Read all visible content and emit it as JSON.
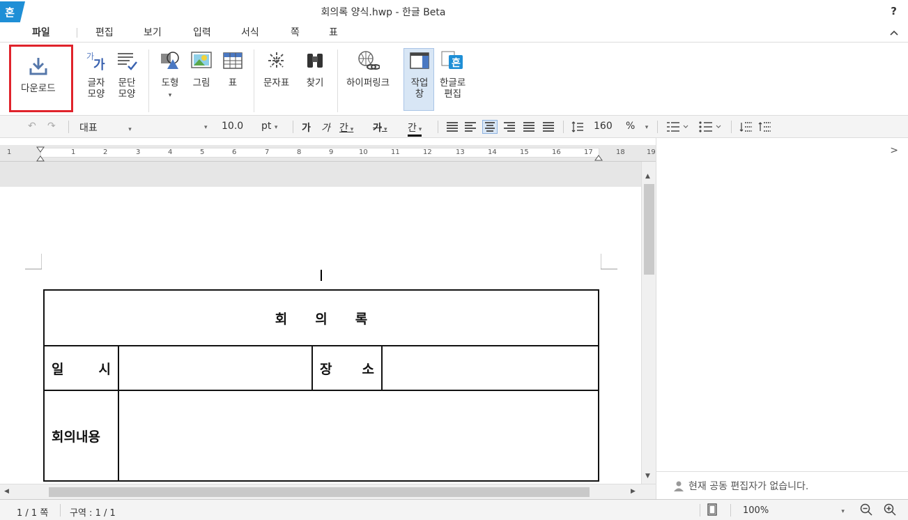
{
  "window": {
    "title": "회의록 양식.hwp - 한글 Beta",
    "logo": "혼",
    "help": "?"
  },
  "menu": {
    "tabs": [
      "파일",
      "편집",
      "보기",
      "입력",
      "서식",
      "쪽",
      "표"
    ],
    "collapse": "^"
  },
  "ribbon": {
    "download": "다운로드",
    "char_shape_1": "글자",
    "char_shape_2": "모양",
    "para_shape_1": "문단",
    "para_shape_2": "모양",
    "shape": "도형",
    "picture": "그림",
    "table": "표",
    "char_map": "문자표",
    "find": "찾기",
    "hyperlink": "하이퍼링크",
    "task_pane_1": "작업",
    "task_pane_2": "창",
    "hangul_edit_1": "한글로",
    "hangul_edit_2": "편집"
  },
  "format": {
    "style": "대표",
    "font_size": "10.0",
    "unit": "pt",
    "line_spacing": "160",
    "percent": "%",
    "bold_glyph": "가",
    "italic_glyph": "가",
    "underline_glyph": "간",
    "strike_glyph": "가",
    "color_glyph": "간"
  },
  "ruler": {
    "numbers": [
      "1",
      "1",
      "2",
      "3",
      "4",
      "5",
      "6",
      "7",
      "8",
      "9",
      "10",
      "11",
      "12",
      "13",
      "14",
      "15",
      "16",
      "17",
      "18",
      "19"
    ]
  },
  "document": {
    "title": "회의록",
    "row1": {
      "label1_a": "일",
      "label1_b": "시",
      "label2_a": "장",
      "label2_b": "소"
    },
    "row2": {
      "label": "회의내용"
    }
  },
  "panel": {
    "no_collaborators": "현재 공동 편집자가 없습니다.",
    "expand": ">"
  },
  "status": {
    "page": "1 / 1 쪽",
    "section": "구역 : 1 / 1",
    "zoom": "100%"
  },
  "colors": {
    "accent": "#1f8fd6",
    "highlight": "#e0232b"
  }
}
